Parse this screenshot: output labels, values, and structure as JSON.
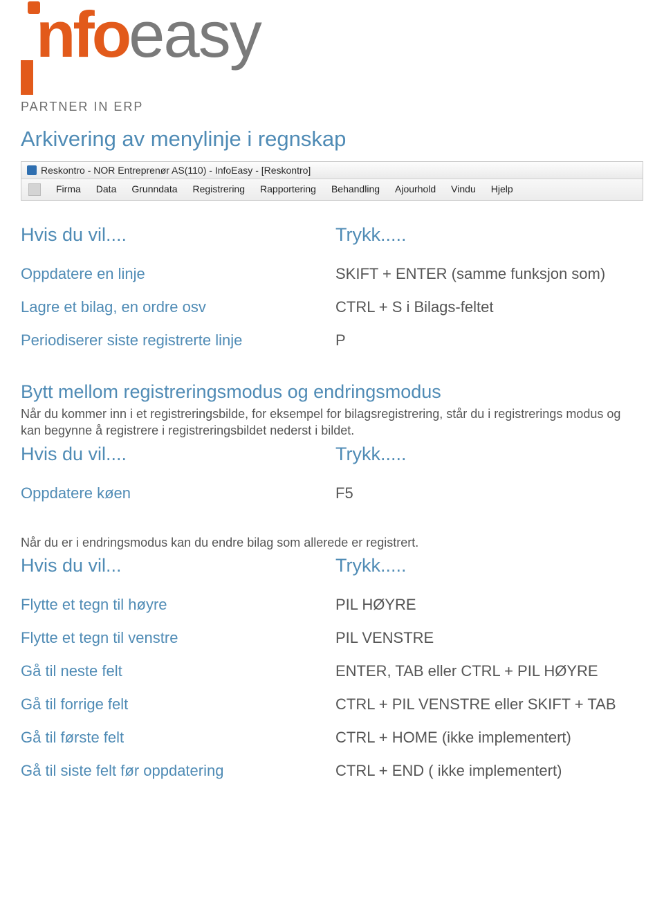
{
  "logo": {
    "text_info": "nfo",
    "text_easy": "easy",
    "tagline": "PARTNER IN ERP"
  },
  "page_title": "Arkivering av menylinje i regnskap",
  "window": {
    "title": "Reskontro - NOR Entreprenør AS(110) - InfoEasy - [Reskontro]",
    "menu": [
      "Firma",
      "Data",
      "Grunndata",
      "Registrering",
      "Rapportering",
      "Behandling",
      "Ajourhold",
      "Vindu",
      "Hjelp"
    ]
  },
  "section1": {
    "left_header": "Hvis du vil....",
    "right_header": "Trykk.....",
    "rows": [
      {
        "left": "Oppdatere en linje",
        "right": "SKIFT + ENTER (samme funksjon som)"
      },
      {
        "left": "Lagre et bilag, en ordre osv",
        "right": "CTRL + S i Bilags-feltet"
      },
      {
        "left": "Periodiserer siste registrerte linje",
        "right": "P"
      }
    ]
  },
  "section2": {
    "heading": "Bytt mellom registreringsmodus og endringsmodus",
    "body": "Når du kommer inn i et registreringsbilde, for eksempel for bilagsregistrering, står du i registrerings modus og kan begynne å registrere i registreringsbildet nederst i bildet.",
    "left_header": "Hvis du vil....",
    "right_header": "Trykk.....",
    "rows": [
      {
        "left": "Oppdatere køen",
        "right": "F5"
      }
    ]
  },
  "section3": {
    "body": "Når du er i endringsmodus kan du endre bilag som allerede er registrert.",
    "left_header": "Hvis du vil...",
    "right_header": "Trykk.....",
    "rows": [
      {
        "left": "Flytte et tegn til høyre",
        "right": "PIL HØYRE"
      },
      {
        "left": "Flytte et tegn til venstre",
        "right": "PIL VENSTRE"
      },
      {
        "left": "Gå til neste felt",
        "right": "ENTER, TAB eller CTRL + PIL HØYRE"
      },
      {
        "left": "Gå til forrige felt",
        "right": "CTRL + PIL VENSTRE eller SKIFT + TAB"
      },
      {
        "left": "Gå til første felt",
        "right": "CTRL + HOME (ikke implementert)"
      },
      {
        "left": "Gå til siste felt før oppdatering",
        "right": "CTRL + END ( ikke implementert)"
      }
    ]
  }
}
